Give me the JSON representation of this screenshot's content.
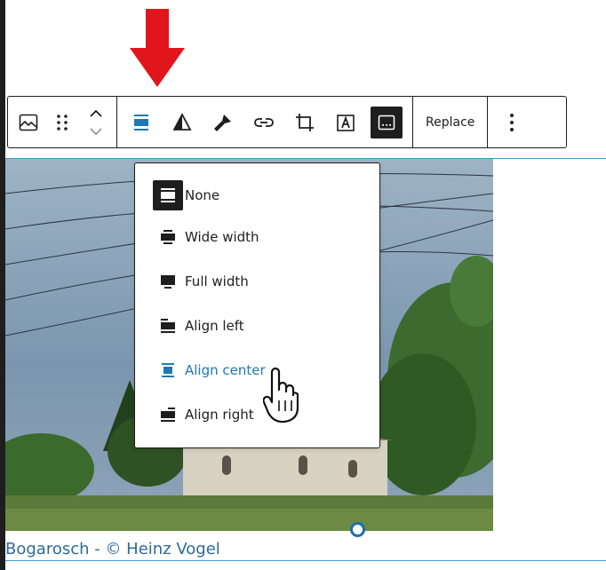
{
  "toolbar": {
    "buttons": [
      {
        "name": "image-icon"
      },
      {
        "name": "drag-handle-icon"
      },
      {
        "name": "move-up-down-icon"
      },
      {
        "name": "align-icon"
      },
      {
        "name": "duotone-icon"
      },
      {
        "name": "filter-brush-icon"
      },
      {
        "name": "link-icon"
      },
      {
        "name": "crop-icon"
      },
      {
        "name": "text-over-image-icon"
      },
      {
        "name": "caption-icon"
      },
      {
        "name": "more-options-icon"
      }
    ],
    "replace_label": "Replace"
  },
  "dropdown": {
    "items": [
      {
        "label": "None",
        "icon": "align-none-icon",
        "highlighted": false
      },
      {
        "label": "Wide width",
        "icon": "align-wide-icon",
        "highlighted": false
      },
      {
        "label": "Full width",
        "icon": "align-full-icon",
        "highlighted": false
      },
      {
        "label": "Align left",
        "icon": "align-left-icon",
        "highlighted": false
      },
      {
        "label": "Align center",
        "icon": "align-center-icon",
        "highlighted": true
      },
      {
        "label": "Align right",
        "icon": "align-right-icon",
        "highlighted": false
      }
    ]
  },
  "image": {
    "caption": "Bogarosch - © Heinz Vogel"
  },
  "colors": {
    "accent": "#1f78b4",
    "dark": "#1e1e1e",
    "arrow": "#e0161c",
    "selection_line": "#3c9bd0",
    "caption_text": "#2f6a9a"
  }
}
